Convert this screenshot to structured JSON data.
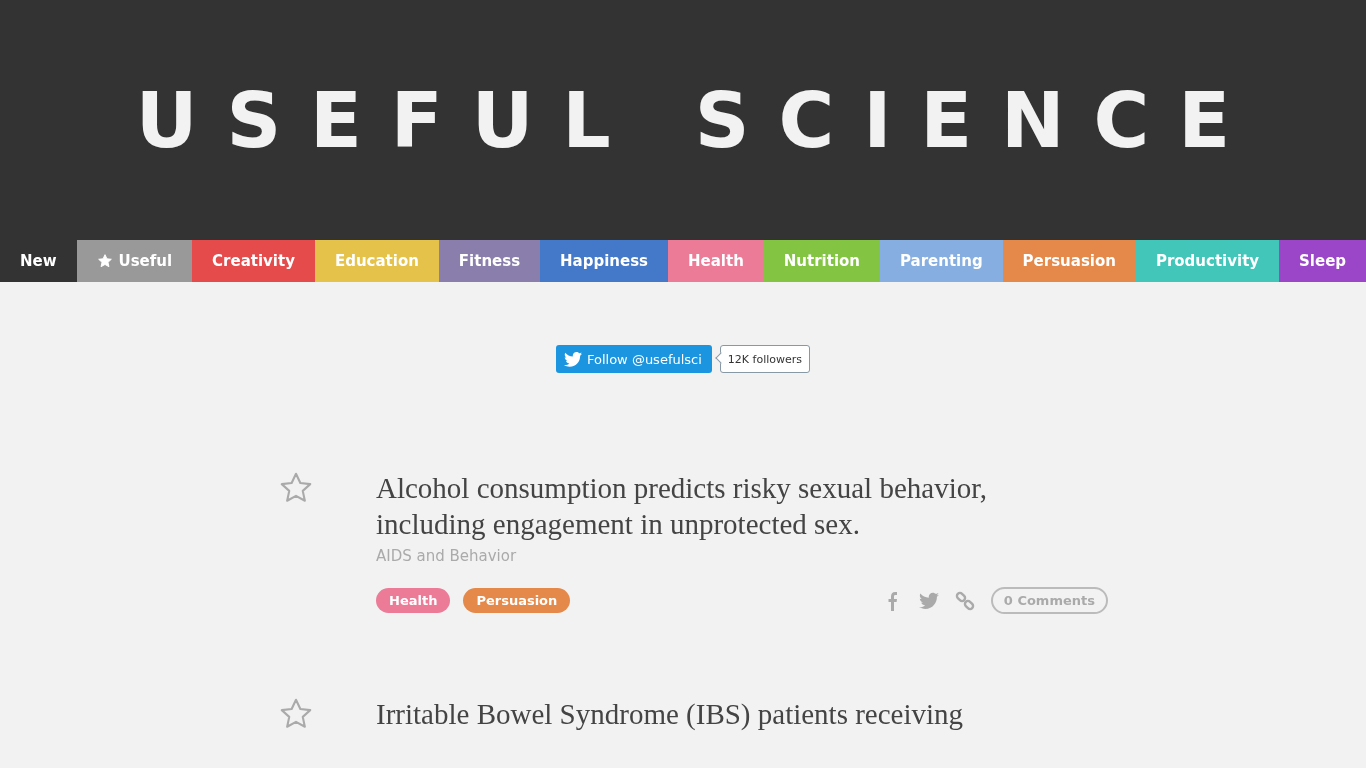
{
  "site": {
    "title": "USEFUL SCIENCE"
  },
  "nav": [
    {
      "label": "New",
      "color": "#333333",
      "icon": false
    },
    {
      "label": "Useful",
      "color": "#999999",
      "icon": true
    },
    {
      "label": "Creativity",
      "color": "#e54b4b",
      "icon": false
    },
    {
      "label": "Education",
      "color": "#e5c34b",
      "icon": false
    },
    {
      "label": "Fitness",
      "color": "#8a7fac",
      "icon": false
    },
    {
      "label": "Happiness",
      "color": "#4479c9",
      "icon": false
    },
    {
      "label": "Health",
      "color": "#ec7b98",
      "icon": false
    },
    {
      "label": "Nutrition",
      "color": "#83c443",
      "icon": false
    },
    {
      "label": "Parenting",
      "color": "#86aee0",
      "icon": false
    },
    {
      "label": "Persuasion",
      "color": "#e5894b",
      "icon": false
    },
    {
      "label": "Productivity",
      "color": "#41c6b9",
      "icon": false
    },
    {
      "label": "Sleep",
      "color": "#9b45c9",
      "icon": false
    }
  ],
  "follow": {
    "button": "Follow @usefulsci",
    "count": "12K followers"
  },
  "articles": [
    {
      "starred": false,
      "title": "Alcohol consumption predicts risky sexual behavior, including engagement in unprotected sex.",
      "source": "AIDS and Behavior",
      "tags": [
        {
          "label": "Health",
          "color": "#ec7b98"
        },
        {
          "label": "Persuasion",
          "color": "#e5894b"
        }
      ],
      "comments": "0 Comments"
    },
    {
      "starred": false,
      "title": "Irritable Bowel Syndrome (IBS) patients receiving"
    }
  ]
}
